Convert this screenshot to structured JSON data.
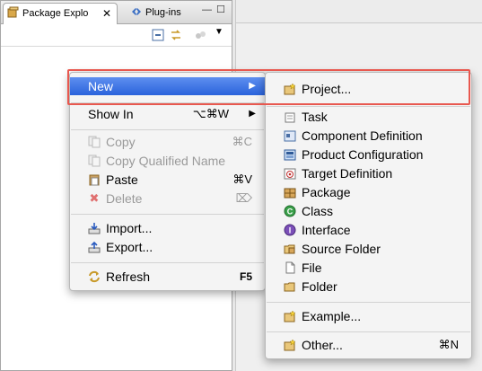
{
  "tabs": {
    "package_explorer": "Package Explo",
    "plugins": "Plug-ins"
  },
  "context_menu": {
    "new": "New",
    "show_in": "Show In",
    "show_in_shortcut": "⌥⌘W",
    "copy": "Copy",
    "copy_shortcut": "⌘C",
    "copy_qualified": "Copy Qualified Name",
    "paste": "Paste",
    "paste_shortcut": "⌘V",
    "delete": "Delete",
    "delete_shortcut": "⌦",
    "import": "Import...",
    "export": "Export...",
    "refresh": "Refresh",
    "refresh_shortcut": "F5"
  },
  "submenu": {
    "project": "Project...",
    "task": "Task",
    "component_definition": "Component Definition",
    "product_configuration": "Product Configuration",
    "target_definition": "Target Definition",
    "package": "Package",
    "class": "Class",
    "interface": "Interface",
    "source_folder": "Source Folder",
    "file": "File",
    "folder": "Folder",
    "example": "Example...",
    "other": "Other...",
    "other_shortcut": "⌘N"
  },
  "colors": {
    "highlight": "#2a63dc",
    "callout_border": "#e8584f"
  }
}
